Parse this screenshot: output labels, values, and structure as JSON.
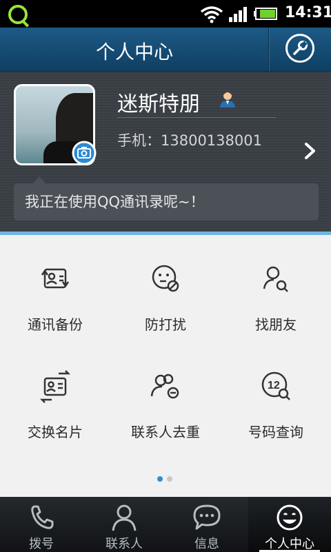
{
  "status_bar": {
    "time": "14:31",
    "app_icon": "qq-icon",
    "wifi_icon": "wifi-icon",
    "signal_icon": "signal-icon",
    "battery_icon": "battery-icon"
  },
  "header": {
    "title": "个人中心",
    "settings_icon": "wrench-icon"
  },
  "profile": {
    "name": "迷斯特朋",
    "phone_label": "手机：13800138001",
    "status_message": "我正在使用QQ通讯录呢~！"
  },
  "features": [
    {
      "label": "通讯备份",
      "icon": "contact-backup-icon"
    },
    {
      "label": "防打扰",
      "icon": "do-not-disturb-icon"
    },
    {
      "label": "找朋友",
      "icon": "find-friends-icon"
    },
    {
      "label": "交换名片",
      "icon": "exchange-card-icon"
    },
    {
      "label": "联系人去重",
      "icon": "dedupe-contacts-icon"
    },
    {
      "label": "号码查询",
      "icon": "number-lookup-icon"
    }
  ],
  "pager": {
    "pages": 2,
    "active_index": 0
  },
  "tabs": [
    {
      "label": "拨号",
      "icon": "phone-icon"
    },
    {
      "label": "联系人",
      "icon": "contacts-icon"
    },
    {
      "label": "信息",
      "icon": "message-icon"
    },
    {
      "label": "个人中心",
      "icon": "smiley-icon"
    }
  ],
  "colors": {
    "header_bg": "#1d5a86",
    "profile_bg": "#3a3f45",
    "accent_blue": "#2d8fd5",
    "grid_bg": "#f1f1f1",
    "tabbar_bg": "#111316"
  }
}
